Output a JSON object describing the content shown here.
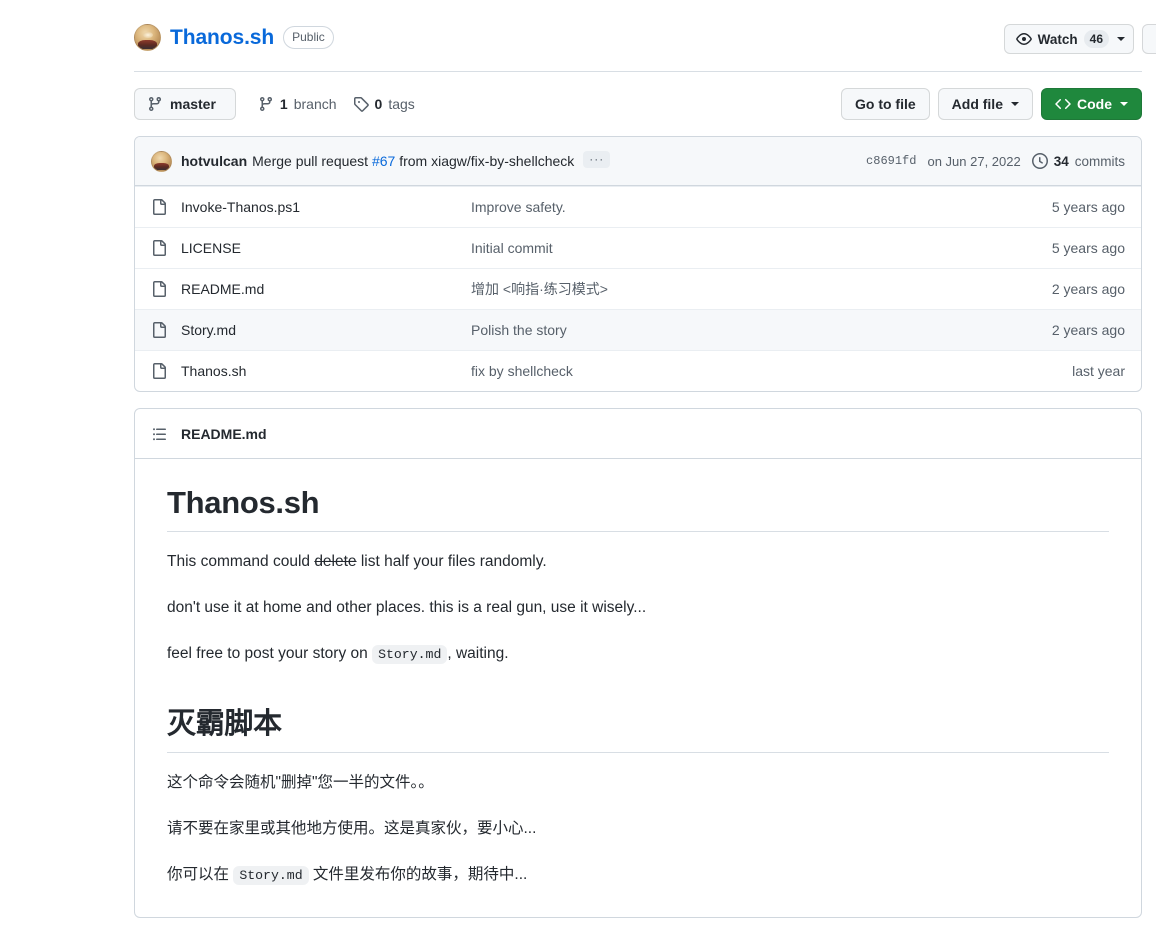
{
  "header": {
    "repo_name": "Thanos.sh",
    "visibility": "Public",
    "avatar_name": "owner-avatar",
    "watch": {
      "label": "Watch",
      "count": "46",
      "icon": "eye-icon"
    }
  },
  "toolbar": {
    "branch_selector": {
      "label": "master",
      "icon": "branch-icon"
    },
    "branches": {
      "count": "1",
      "label": "branch",
      "icon": "branch-icon"
    },
    "tags": {
      "count": "0",
      "label": "tags",
      "icon": "tag-icon"
    },
    "go_to_file": "Go to file",
    "add_file": "Add file",
    "code": "Code",
    "code_icon": "code-brackets-icon"
  },
  "commit_bar": {
    "author": "hotvulcan",
    "message_prefix": "Merge pull request ",
    "pr_number": "#67",
    "message_suffix": " from xiagw/fix-by-shellcheck",
    "ellipsis": "···",
    "sha": "c8691fd",
    "date": "on Jun 27, 2022",
    "commits_count": "34",
    "commits_label": "commits",
    "history_icon": "clock-icon"
  },
  "files": {
    "rows": [
      {
        "name": "Invoke-Thanos.ps1",
        "message": "Improve safety.",
        "time": "5 years ago",
        "hovered": false
      },
      {
        "name": "LICENSE",
        "message": "Initial commit",
        "time": "5 years ago",
        "hovered": false
      },
      {
        "name": "README.md",
        "message": "增加 <响指·练习模式>",
        "time": "2 years ago",
        "hovered": false
      },
      {
        "name": "Story.md",
        "message": "Polish the story",
        "time": "2 years ago",
        "hovered": true
      },
      {
        "name": "Thanos.sh",
        "message": "fix by shellcheck",
        "time": "last year",
        "hovered": false
      }
    ]
  },
  "readme": {
    "header_title": "README.md",
    "header_icon": "list-unordered-icon",
    "heading_en": "Thanos.sh",
    "para1_a": "This command could ",
    "para1_strike": "delete",
    "para1_b": " list half your files randomly.",
    "para2": "don't use it at home and other places. this is a real gun, use it wisely...",
    "para3_a": "feel free to post your story on ",
    "para3_code": "Story.md",
    "para3_b": ", waiting.",
    "heading_cn": "灭霸脚本",
    "para4": "这个命令会随机\"删掉\"您一半的文件。。",
    "para5": "请不要在家里或其他地方使用。这是真家伙，要小心...",
    "para6_a": "你可以在 ",
    "para6_code": "Story.md",
    "para6_b": " 文件里发布你的故事，期待中..."
  },
  "colors": {
    "accent_green": "#1f883d",
    "link_blue": "#0969da",
    "text_primary": "#24292f",
    "text_muted": "#57606a",
    "border": "#d0d7de"
  }
}
